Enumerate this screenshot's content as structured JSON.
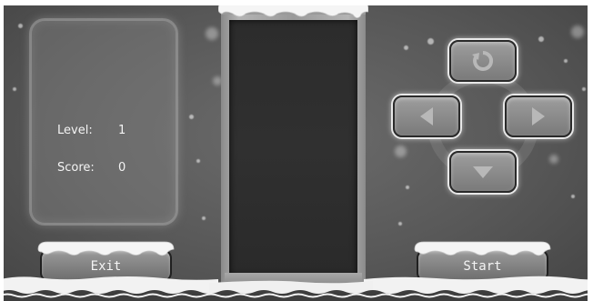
{
  "stats": {
    "level_label": "Level:",
    "level_value": "1",
    "score_label": "Score:",
    "score_value": "0"
  },
  "controls": {
    "rotate_icon": "rotate-icon",
    "left_icon": "arrow-left-icon",
    "right_icon": "arrow-right-icon",
    "down_icon": "arrow-down-icon"
  },
  "buttons": {
    "exit_label": "Exit",
    "start_label": "Start"
  },
  "colors": {
    "background": "#5a5a5a",
    "board": "#2e2e2e",
    "text": "#f4f4f4"
  }
}
